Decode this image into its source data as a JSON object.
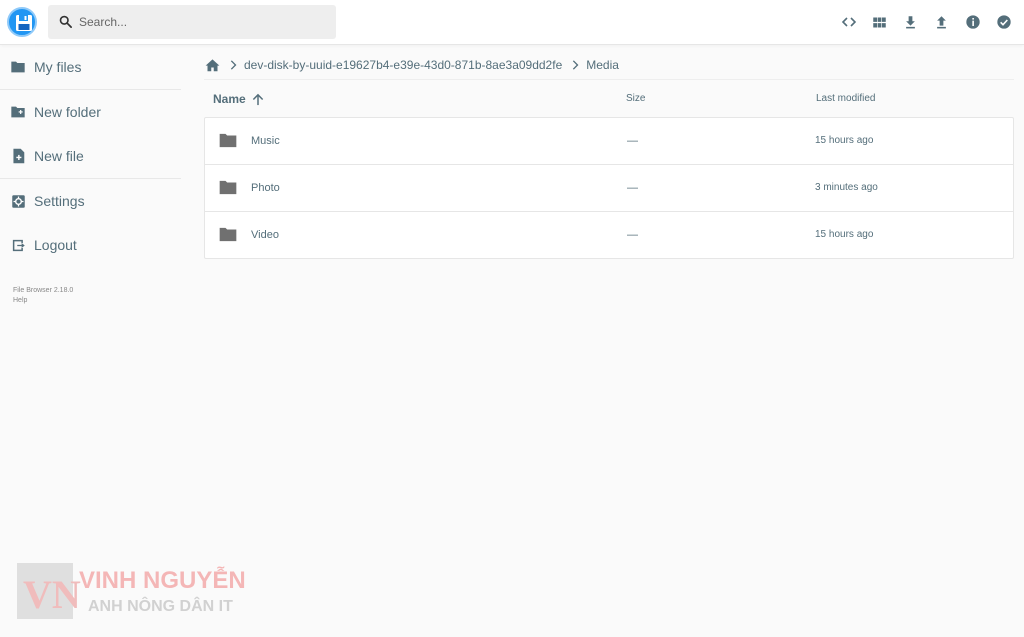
{
  "search": {
    "placeholder": "Search..."
  },
  "header": {
    "actions": [
      {
        "name": "toggle-view-icon"
      },
      {
        "name": "grid-view-icon"
      },
      {
        "name": "download-icon"
      },
      {
        "name": "upload-icon"
      },
      {
        "name": "info-icon"
      },
      {
        "name": "select-icon"
      }
    ]
  },
  "sidebar": {
    "items": [
      {
        "label": "My files",
        "icon": "folder-icon"
      },
      {
        "label": "New folder",
        "icon": "new-folder-icon"
      },
      {
        "label": "New file",
        "icon": "new-file-icon"
      },
      {
        "label": "Settings",
        "icon": "settings-icon"
      },
      {
        "label": "Logout",
        "icon": "logout-icon"
      }
    ],
    "credits": {
      "version": "File Browser 2.18.0",
      "help": "Help"
    }
  },
  "breadcrumb": {
    "items": [
      "dev-disk-by-uuid-e19627b4-e39e-43d0-871b-8ae3a09dd2fe",
      "Media"
    ]
  },
  "list": {
    "columns": {
      "name": "Name",
      "size": "Size",
      "modified": "Last modified"
    },
    "rows": [
      {
        "name": "Music",
        "size": "—",
        "modified": "15 hours ago"
      },
      {
        "name": "Photo",
        "size": "—",
        "modified": "3 minutes ago"
      },
      {
        "name": "Video",
        "size": "—",
        "modified": "15 hours ago"
      }
    ]
  },
  "watermark": {
    "line1": "VINH NGUYỄN",
    "line2": "ANH NÔNG DÂN IT",
    "logo": "VN"
  },
  "colors": {
    "accent": "#2196f3",
    "text": "#546e7a",
    "icon": "#546e7a",
    "folder": "#707070"
  }
}
